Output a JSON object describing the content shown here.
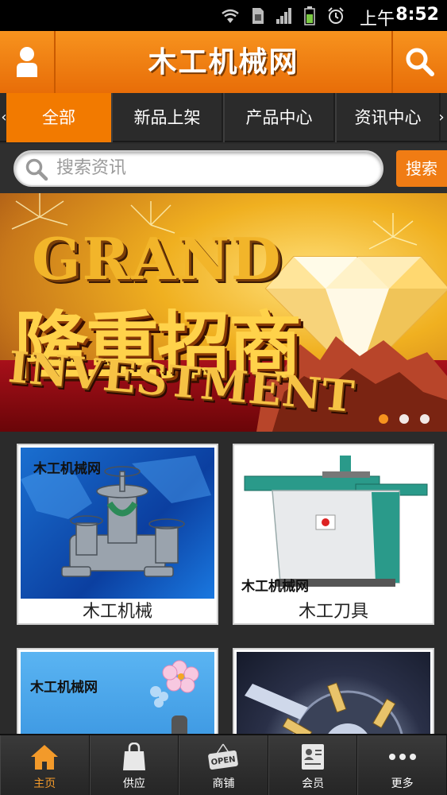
{
  "status_bar": {
    "ampm": "上午",
    "time": "8:52"
  },
  "header": {
    "title": "木工机械网",
    "user_icon": "user-icon",
    "search_icon": "search-icon"
  },
  "nav": {
    "tabs": [
      {
        "label": "全部",
        "active": true
      },
      {
        "label": "新品上架",
        "active": false
      },
      {
        "label": "产品中心",
        "active": false
      },
      {
        "label": "资讯中心",
        "active": false
      }
    ],
    "left_arrow": "‹",
    "right_arrow": "›"
  },
  "search": {
    "placeholder": "搜索资讯",
    "button": "搜索"
  },
  "banner": {
    "grand": "GRAND",
    "headline": "隆重招商",
    "investment": "INVESTMENT",
    "slide_count": 3,
    "active_slide": 1
  },
  "products": [
    {
      "caption": "木工机械",
      "brand": "木工机械网"
    },
    {
      "caption": "木工刀具",
      "brand": "木工机械网"
    },
    {
      "caption": "",
      "brand": "木工机械网"
    },
    {
      "caption": "",
      "brand": ""
    }
  ],
  "tabbar": {
    "items": [
      {
        "label": "主页",
        "icon": "home-icon",
        "active": true
      },
      {
        "label": "供应",
        "icon": "shopping-bag-icon",
        "active": false
      },
      {
        "label": "商铺",
        "icon": "open-sign-icon",
        "active": false,
        "sign_text": "OPEN"
      },
      {
        "label": "会员",
        "icon": "member-card-icon",
        "active": false
      },
      {
        "label": "更多",
        "icon": "more-icon",
        "active": false
      }
    ]
  },
  "colors": {
    "accent": "#f27a00",
    "background": "#2b2b2b",
    "tab_active": "#f39a2a"
  }
}
